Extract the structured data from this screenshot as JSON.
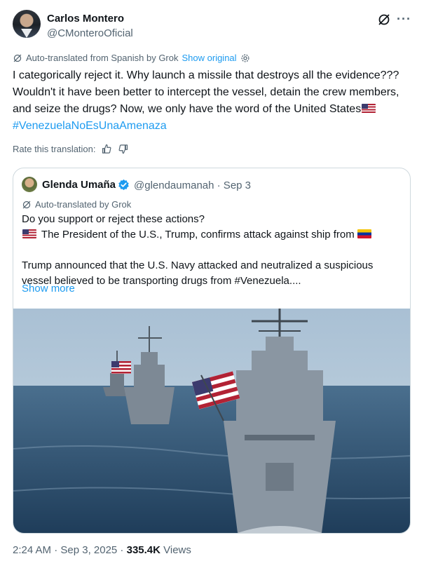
{
  "author": {
    "name": "Carlos Montero",
    "handle": "@CMonteroOficial"
  },
  "header_icons": {
    "grok": "grok-icon",
    "more": "more-icon",
    "more_glyph": "···"
  },
  "translation": {
    "label": "Auto-translated from Spanish by Grok",
    "show_original": "Show original"
  },
  "tweet": {
    "text_main": "I categorically reject it. Why launch a missile that destroys all the evidence??? Wouldn't it have been better to intercept the vessel, detain the crew members, and seize the drugs? Now, we only have the word of the United States",
    "hashtag": "#VenezuelaNoEsUnaAmenaza"
  },
  "rate": {
    "label": "Rate this translation:"
  },
  "quote": {
    "name": "Glenda Umaña",
    "handle_date": "@glendaumanah · Sep 3",
    "translation_label": "Auto-translated by Grok",
    "line1": "Do you support or reject these actions?",
    "line2": "The President of the U.S., Trump, confirms attack against ship from",
    "para2": "Trump announced that the U.S. Navy attacked and neutralized a suspicious vessel believed to be transporting drugs from #Venezuela....",
    "show_more": "Show more"
  },
  "meta": {
    "time_date": "2:24 AM · Sep 3, 2025 · ",
    "views_count": "335.4K",
    "views_label": " Views"
  },
  "colors": {
    "link": "#1d9bf0",
    "text": "#0f1419",
    "muted": "#536471",
    "border": "#cfd9de"
  }
}
